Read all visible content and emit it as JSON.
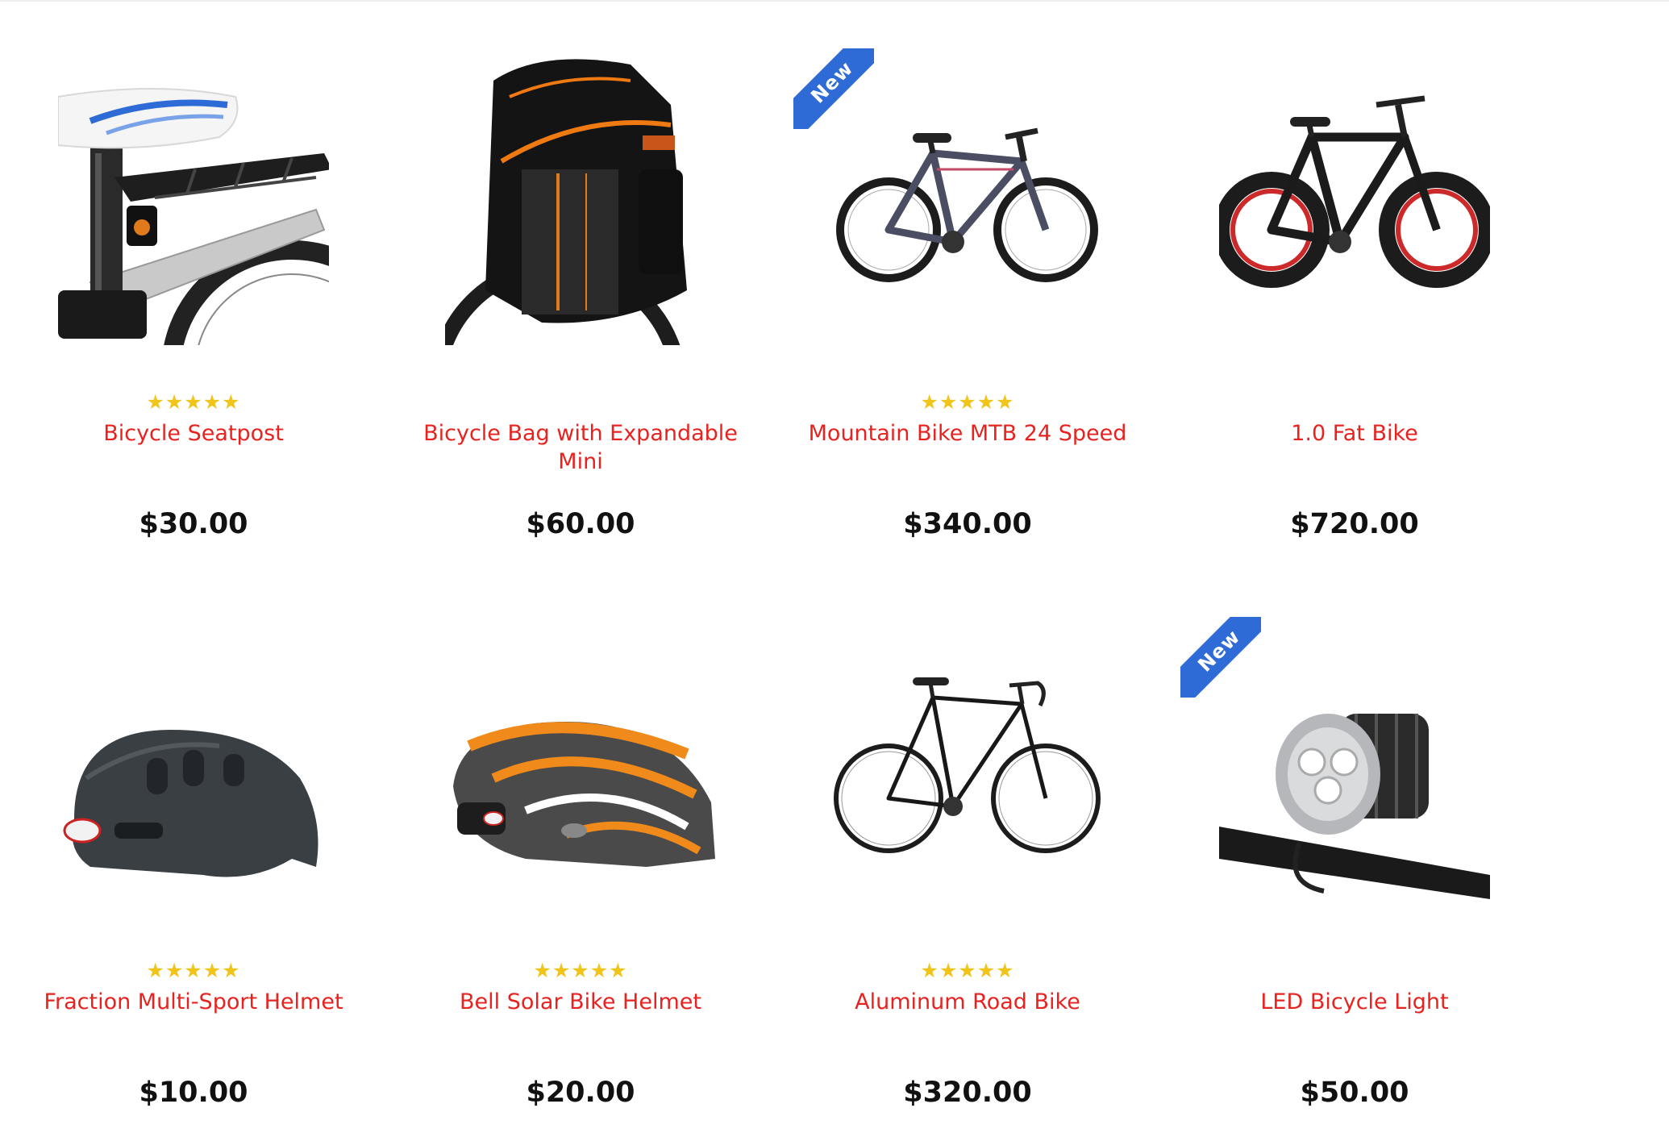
{
  "products": [
    {
      "name": "Bicycle Seatpost",
      "price": "$30.00",
      "rating": "★★★★★",
      "badge": "",
      "icon": "seatpost-image"
    },
    {
      "name": "Bicycle Bag with Expandable Mini",
      "price": "$60.00",
      "rating": "",
      "badge": "",
      "icon": "bike-bag-image"
    },
    {
      "name": "Mountain Bike MTB 24 Speed",
      "price": "$340.00",
      "rating": "★★★★★",
      "badge": "New",
      "icon": "mountain-bike-image"
    },
    {
      "name": "1.0 Fat Bike",
      "price": "$720.00",
      "rating": "",
      "badge": "",
      "icon": "fat-bike-image"
    },
    {
      "name": "Fraction Multi-Sport Helmet",
      "price": "$10.00",
      "rating": "★★★★★",
      "badge": "",
      "icon": "helmet-image"
    },
    {
      "name": "Bell Solar Bike Helmet",
      "price": "$20.00",
      "rating": "★★★★★",
      "badge": "",
      "icon": "bike-helmet-image"
    },
    {
      "name": "Aluminum Road Bike",
      "price": "$320.00",
      "rating": "★★★★★",
      "badge": "",
      "icon": "road-bike-image"
    },
    {
      "name": "LED Bicycle Light",
      "price": "$50.00",
      "rating": "",
      "badge": "New",
      "icon": "bike-light-image"
    }
  ],
  "colors": {
    "product_name": "#e8231f",
    "price": "#111111",
    "star": "#f0c419",
    "badge": "#2f6bd6"
  }
}
